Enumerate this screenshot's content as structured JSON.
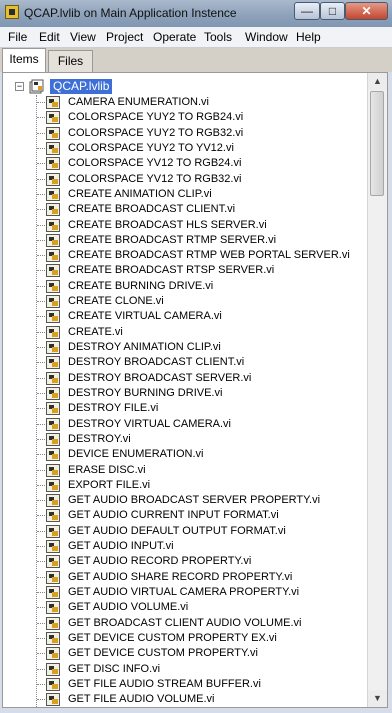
{
  "window": {
    "title": "QCAP.lvlib on Main Application Instence"
  },
  "window_buttons": {
    "minimize": "—",
    "maximize": "□",
    "close": "✕"
  },
  "menu": [
    "File",
    "Edit",
    "View",
    "Project",
    "Operate",
    "Tools",
    "Window",
    "Help"
  ],
  "tabs": [
    {
      "label": "Items",
      "active": true
    },
    {
      "label": "Files",
      "active": false
    }
  ],
  "tree": {
    "root": {
      "label": "QCAP.lvlib",
      "expander": "−"
    },
    "items": [
      "CAMERA ENUMERATION.vi",
      "COLORSPACE YUY2 TO RGB24.vi",
      "COLORSPACE YUY2 TO RGB32.vi",
      "COLORSPACE YUY2 TO YV12.vi",
      "COLORSPACE YV12 TO RGB24.vi",
      "COLORSPACE YV12 TO RGB32.vi",
      "CREATE ANIMATION CLIP.vi",
      "CREATE BROADCAST CLIENT.vi",
      "CREATE BROADCAST HLS SERVER.vi",
      "CREATE BROADCAST RTMP SERVER.vi",
      "CREATE BROADCAST RTMP WEB PORTAL SERVER.vi",
      "CREATE BROADCAST RTSP SERVER.vi",
      "CREATE BURNING DRIVE.vi",
      "CREATE CLONE.vi",
      "CREATE VIRTUAL CAMERA.vi",
      "CREATE.vi",
      "DESTROY ANIMATION CLIP.vi",
      "DESTROY BROADCAST CLIENT.vi",
      "DESTROY BROADCAST SERVER.vi",
      "DESTROY BURNING DRIVE.vi",
      "DESTROY FILE.vi",
      "DESTROY VIRTUAL CAMERA.vi",
      "DESTROY.vi",
      "DEVICE ENUMERATION.vi",
      "ERASE DISC.vi",
      "EXPORT FILE.vi",
      "GET AUDIO BROADCAST SERVER PROPERTY.vi",
      "GET AUDIO CURRENT INPUT FORMAT.vi",
      "GET AUDIO DEFAULT OUTPUT FORMAT.vi",
      "GET AUDIO INPUT.vi",
      "GET AUDIO RECORD PROPERTY.vi",
      "GET AUDIO SHARE RECORD PROPERTY.vi",
      "GET AUDIO VIRTUAL CAMERA PROPERTY.vi",
      "GET AUDIO VOLUME.vi",
      "GET BROADCAST CLIENT AUDIO VOLUME.vi",
      "GET DEVICE CUSTOM PROPERTY EX.vi",
      "GET DEVICE CUSTOM PROPERTY.vi",
      "GET DISC INFO.vi",
      "GET FILE AUDIO STREAM BUFFER.vi",
      "GET FILE AUDIO VOLUME.vi"
    ]
  },
  "scrollbar": {
    "up": "▲",
    "down": "▼"
  }
}
